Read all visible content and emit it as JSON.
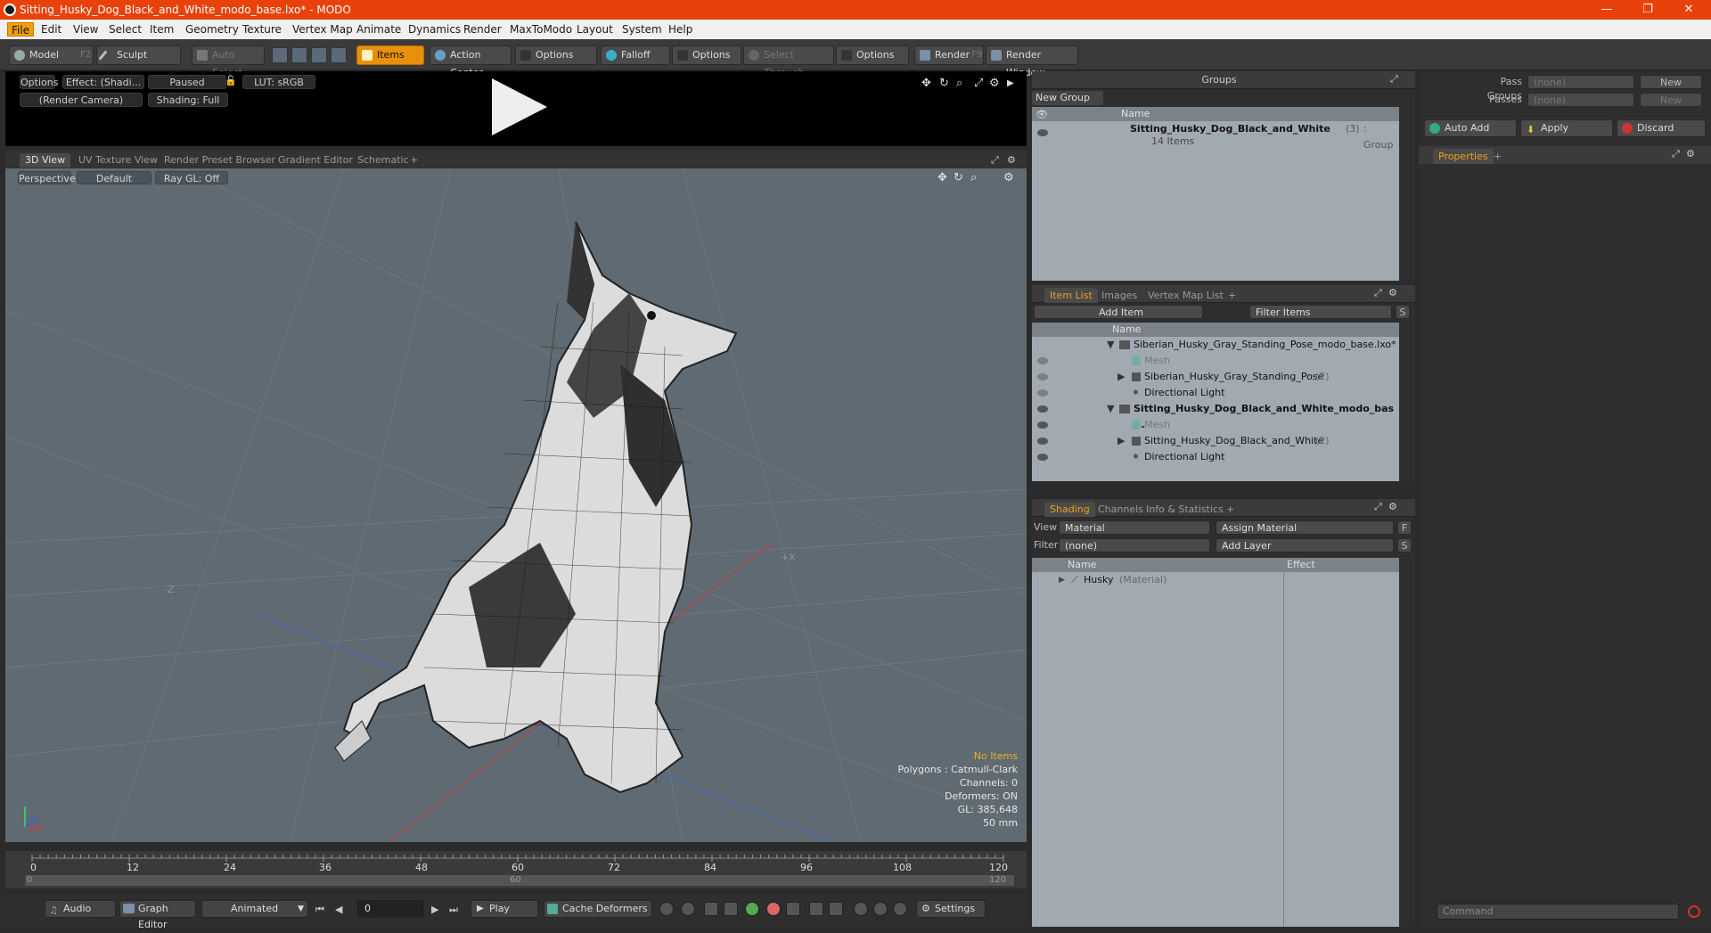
{
  "window": {
    "title": "Sitting_Husky_Dog_Black_and_White_modo_base.lxo* - MODO",
    "minimize": "—",
    "maximize": "❐",
    "close": "✕"
  },
  "menu": [
    "File",
    "Edit",
    "View",
    "Select",
    "Item",
    "Geometry",
    "Texture",
    "Vertex Map",
    "Animate",
    "Dynamics",
    "Render",
    "MaxToModo",
    "Layout",
    "System",
    "Help"
  ],
  "toolbar": {
    "model": "Model",
    "model_key": "F2",
    "sculpt": "Sculpt",
    "auto_select": "Auto Select",
    "items": "Items",
    "action_center": "Action Center",
    "options1": "Options",
    "falloff": "Falloff",
    "options2": "Options",
    "select_through": "Select Through",
    "options3": "Options",
    "render": "Render",
    "render_key": "F9",
    "render_window": "Render Window"
  },
  "preview": {
    "options": "Options",
    "effect": "Effect: (Shadi...",
    "paused": "Paused",
    "lut": "LUT: sRGB",
    "camera": "(Render Camera)",
    "shading": "Shading: Full"
  },
  "viewport_tabs": [
    "3D View",
    "UV Texture View",
    "Render Preset Browser",
    "Gradient Editor",
    "Schematic",
    "+"
  ],
  "viewport": {
    "perspective": "Perspective",
    "default": "Default",
    "raygl": "Ray GL: Off",
    "axis_z": "-Z",
    "axis_x": "+X"
  },
  "stats": {
    "items": "No Items",
    "polygons": "Polygons : Catmull-Clark",
    "channels": "Channels: 0",
    "deformers": "Deformers: ON",
    "gl": "GL: 385,648",
    "size": "50 mm"
  },
  "timeline": {
    "ticks": [
      "0",
      "12",
      "24",
      "36",
      "48",
      "60",
      "72",
      "84",
      "96",
      "108",
      "120"
    ],
    "start": "0",
    "mid": "60",
    "end": "120"
  },
  "bottom": {
    "audio": "Audio",
    "graph_editor": "Graph Editor",
    "animated": "Animated",
    "frame": "0",
    "play": "Play",
    "cache": "Cache Deformers",
    "settings": "Settings"
  },
  "groups": {
    "title": "Groups",
    "new_group": "New Group",
    "col_name": "Name",
    "item_name": "Sitting_Husky_Dog_Black_and_White",
    "item_count": "(3)",
    "item_type": ": Group",
    "item_sub": "14 Items"
  },
  "pass": {
    "pass_groups": "Pass Groups",
    "passes": "Passes",
    "none1": "(none)",
    "none2": "(none)",
    "new1": "New",
    "new2": "New"
  },
  "props_actions": {
    "auto_add": "Auto Add",
    "apply": "Apply",
    "discard": "Discard",
    "properties": "Properties",
    "plus": "+"
  },
  "itemlist": {
    "tabs": [
      "Item List",
      "Images",
      "Vertex Map List",
      "+"
    ],
    "add_item": "Add Item",
    "filter": "Filter Items",
    "s": "S",
    "f": "F",
    "col_name": "Name",
    "rows": [
      {
        "text": "Siberian_Husky_Gray_Standing_Pose_modo_base.lxo*",
        "suffix": "",
        "bold": false
      },
      {
        "text": "Mesh",
        "suffix": "",
        "bold": false
      },
      {
        "text": "Siberian_Husky_Gray_Standing_Pose",
        "suffix": "(2)",
        "bold": false
      },
      {
        "text": "Directional Light",
        "suffix": "",
        "bold": false
      },
      {
        "text": "Sitting_Husky_Dog_Black_and_White_modo_bas ...",
        "suffix": "",
        "bold": true
      },
      {
        "text": "Mesh",
        "suffix": "",
        "bold": false
      },
      {
        "text": "Sitting_Husky_Dog_Black_and_White",
        "suffix": "(2)",
        "bold": false
      },
      {
        "text": "Directional Light",
        "suffix": "",
        "bold": false
      }
    ]
  },
  "shading": {
    "tabs": [
      "Shading",
      "Channels",
      "Info & Statistics",
      "+"
    ],
    "view_label": "View",
    "view_value": "Material",
    "assign": "Assign Material",
    "f": "F",
    "filter_label": "Filter",
    "filter_value": "(none)",
    "add_layer": "Add Layer",
    "s": "S",
    "col_name": "Name",
    "col_effect": "Effect",
    "row_name": "Husky",
    "row_type": "(Material)"
  },
  "command": {
    "placeholder": "Command"
  }
}
